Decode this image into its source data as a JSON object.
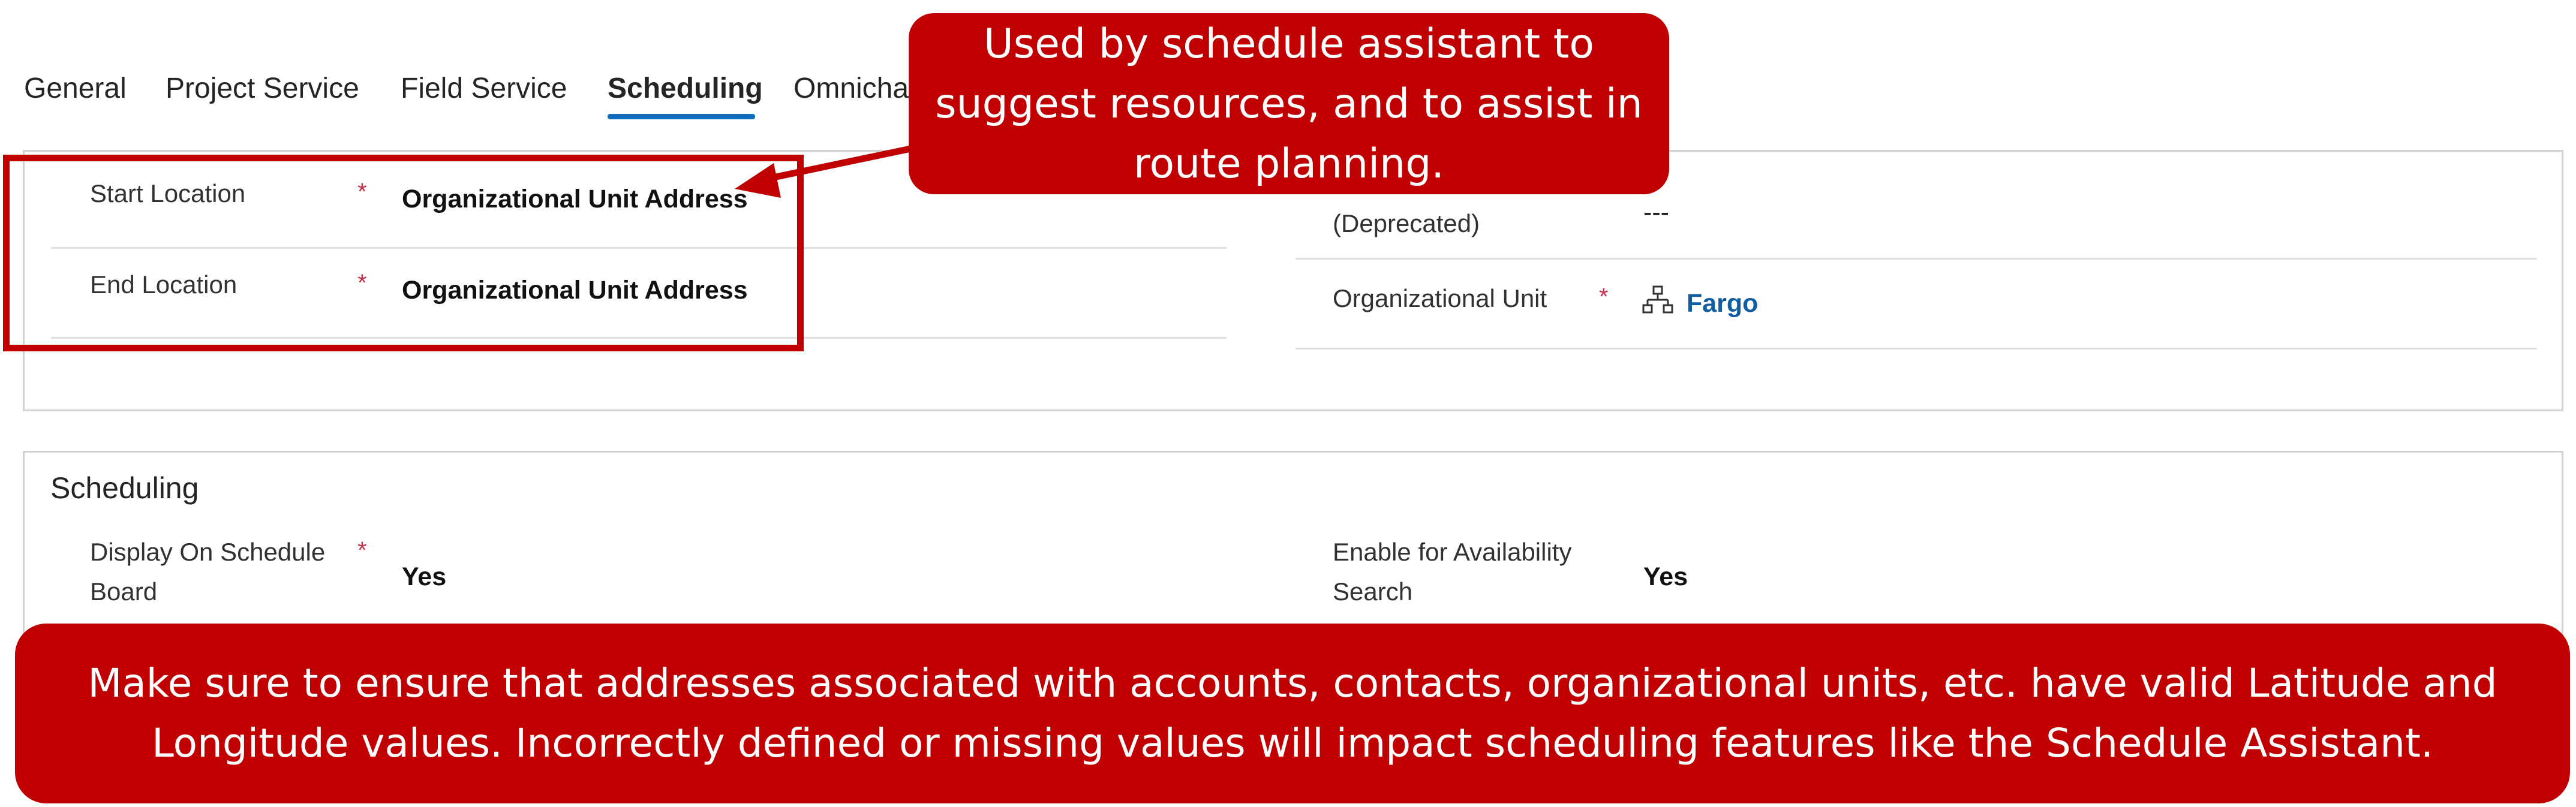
{
  "tabs": [
    {
      "label": "General"
    },
    {
      "label": "Project Service"
    },
    {
      "label": "Field Service"
    },
    {
      "label": "Scheduling"
    },
    {
      "label": "Omnicha"
    }
  ],
  "location_panel": {
    "start_location": {
      "label": "Start Location",
      "required": "*",
      "value": "Organizational Unit Address"
    },
    "end_location": {
      "label": "End Location",
      "required": "*",
      "value": "Organizational Unit Address"
    },
    "deprecated_field": {
      "label": "(Deprecated)",
      "value": "---"
    },
    "org_unit": {
      "label": "Organizational Unit",
      "required": "*",
      "value": "Fargo",
      "icon": "org-hierarchy-icon"
    }
  },
  "scheduling_section": {
    "title": "Scheduling",
    "display_on_board": {
      "label_line1": "Display On Schedule",
      "label_line2": "Board",
      "required": "*",
      "value": "Yes"
    },
    "enable_availability": {
      "label_line1": "Enable for Availability",
      "label_line2": "Search",
      "value": "Yes"
    }
  },
  "callouts": {
    "top": {
      "line1": "Used by schedule assistant to",
      "line2": "suggest resources, and to assist in",
      "line3": "route planning."
    },
    "bottom": {
      "line1": "Make sure to ensure that addresses associated with accounts, contacts, organizational units, etc. have valid Latitude and",
      "line2": "Longitude values.  Incorrectly defined or missing values will impact scheduling features like the Schedule Assistant."
    }
  },
  "colors": {
    "callout_bg": "#c00000",
    "tab_underline": "#0f6cbd",
    "required": "#c4314b",
    "link": "#115ea3"
  }
}
